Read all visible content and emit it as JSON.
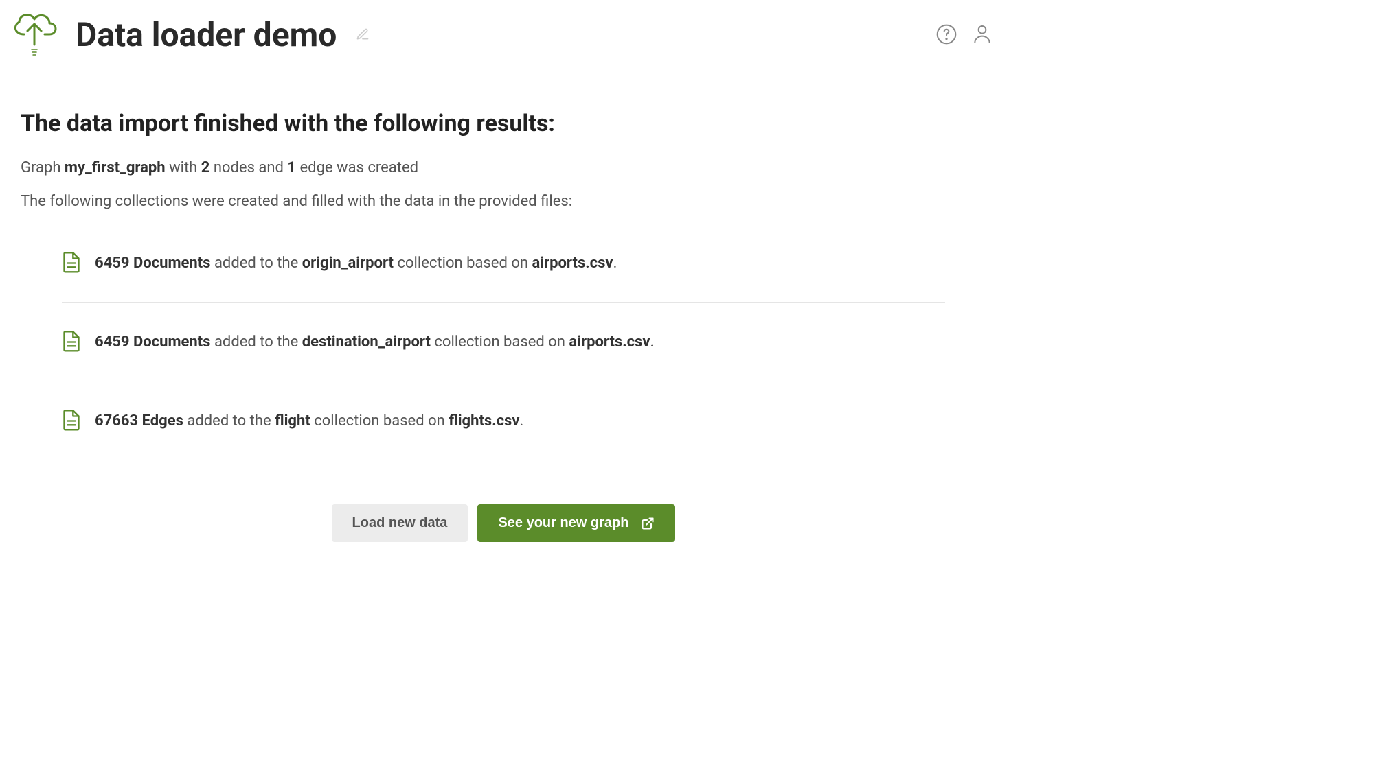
{
  "header": {
    "title": "Data loader demo"
  },
  "results": {
    "heading": "The data import finished with the following results:",
    "graph_label": "Graph",
    "graph_name": "my_first_graph",
    "with_text": "with",
    "node_count": "2",
    "nodes_text": "nodes and",
    "edge_count": "1",
    "edge_text": "edge was created",
    "collections_intro": "The following collections were created and filled with the data in the provided files:",
    "items": [
      {
        "count": "6459",
        "type": "Documents",
        "middle": "added to the",
        "collection": "origin_airport",
        "suffix": "collection based on",
        "file": "airports.csv",
        "end": "."
      },
      {
        "count": "6459",
        "type": "Documents",
        "middle": "added to the",
        "collection": "destination_airport",
        "suffix": "collection based on",
        "file": "airports.csv",
        "end": "."
      },
      {
        "count": "67663",
        "type": "Edges",
        "middle": "added to the",
        "collection": "flight",
        "suffix": "collection based on",
        "file": "flights.csv",
        "end": "."
      }
    ]
  },
  "buttons": {
    "load_new": "Load new data",
    "see_graph": "See your new graph"
  }
}
